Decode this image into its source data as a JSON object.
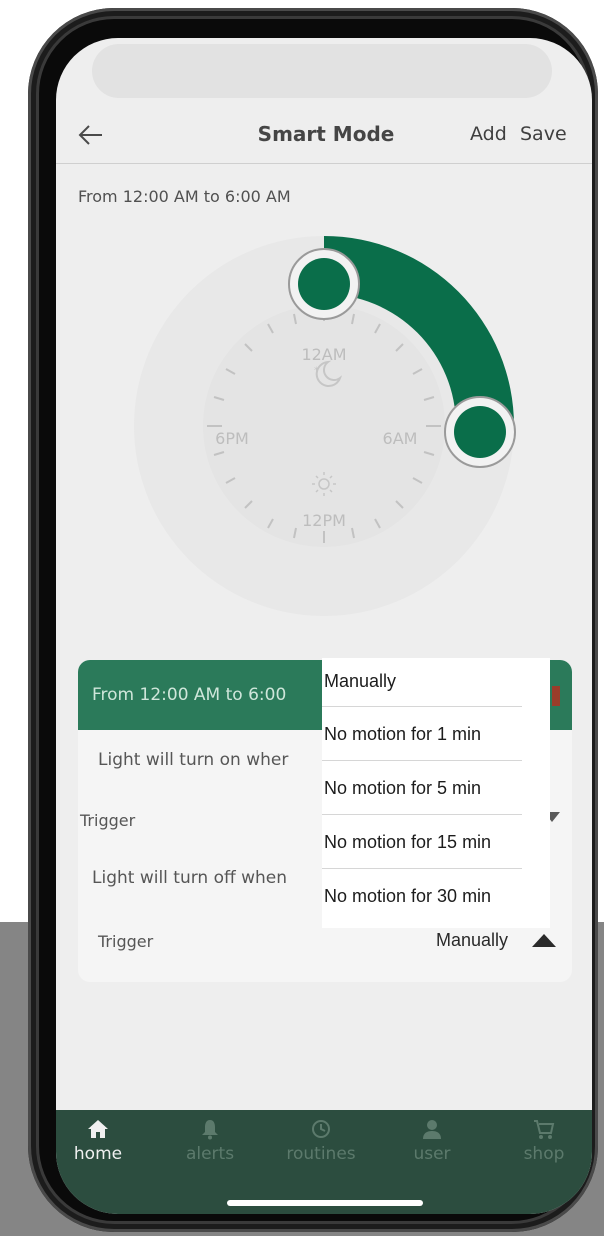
{
  "header": {
    "title": "Smart Mode",
    "add_label": "Add",
    "save_label": "Save",
    "back_icon": "back-arrow-icon"
  },
  "schedule": {
    "range_text": "From 12:00 AM to 6:00 AM",
    "start_time": "12:00 AM",
    "end_time": "6:00 AM"
  },
  "clock": {
    "labels": {
      "top": "12AM",
      "right": "6AM",
      "bottom": "12PM",
      "left": "6PM"
    },
    "top_icon": "moon-icon",
    "bottom_icon": "sun-icon",
    "arc_color": "#0a6e4a"
  },
  "card": {
    "header_text": "From 12:00 AM to 6:00",
    "on_label": "Light will turn on wher",
    "on_trigger_label": "Trigger",
    "off_label": "Light will turn off when",
    "off_trigger_label": "Trigger",
    "off_trigger_value": "Manually"
  },
  "dropdown": {
    "options": [
      "Manually",
      "No motion for 1 min",
      "No motion for 5 min",
      "No motion for 15 min",
      "No motion for 30 min"
    ]
  },
  "bottom_nav": {
    "items": [
      {
        "label": "home",
        "icon": "home-icon",
        "active": true
      },
      {
        "label": "alerts",
        "icon": "bell-icon",
        "active": false
      },
      {
        "label": "routines",
        "icon": "routines-clock-icon",
        "active": false
      },
      {
        "label": "user",
        "icon": "user-icon",
        "active": false
      },
      {
        "label": "shop",
        "icon": "cart-icon",
        "active": false
      }
    ]
  },
  "colors": {
    "accent": "#2b7a5a",
    "nav_bg": "#2c4d3f",
    "arc": "#0a6e4a"
  }
}
